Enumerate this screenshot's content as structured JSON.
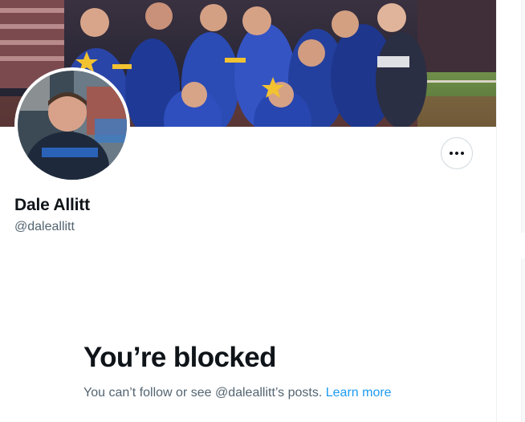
{
  "profile": {
    "display_name": "Dale Allitt",
    "handle": "@daleallitt",
    "banner_image": "team-photo-banner",
    "avatar_image": "profile-photo"
  },
  "actions": {
    "more_icon": "more-horizontal-icon"
  },
  "blocked": {
    "title": "You’re blocked",
    "message": "You can’t follow or see @daleallitt’s posts.",
    "link_label": "Learn more"
  },
  "colors": {
    "primary_text": "#0f1419",
    "secondary_text": "#536471",
    "link": "#1d9bf0",
    "border": "#cfd9de"
  }
}
